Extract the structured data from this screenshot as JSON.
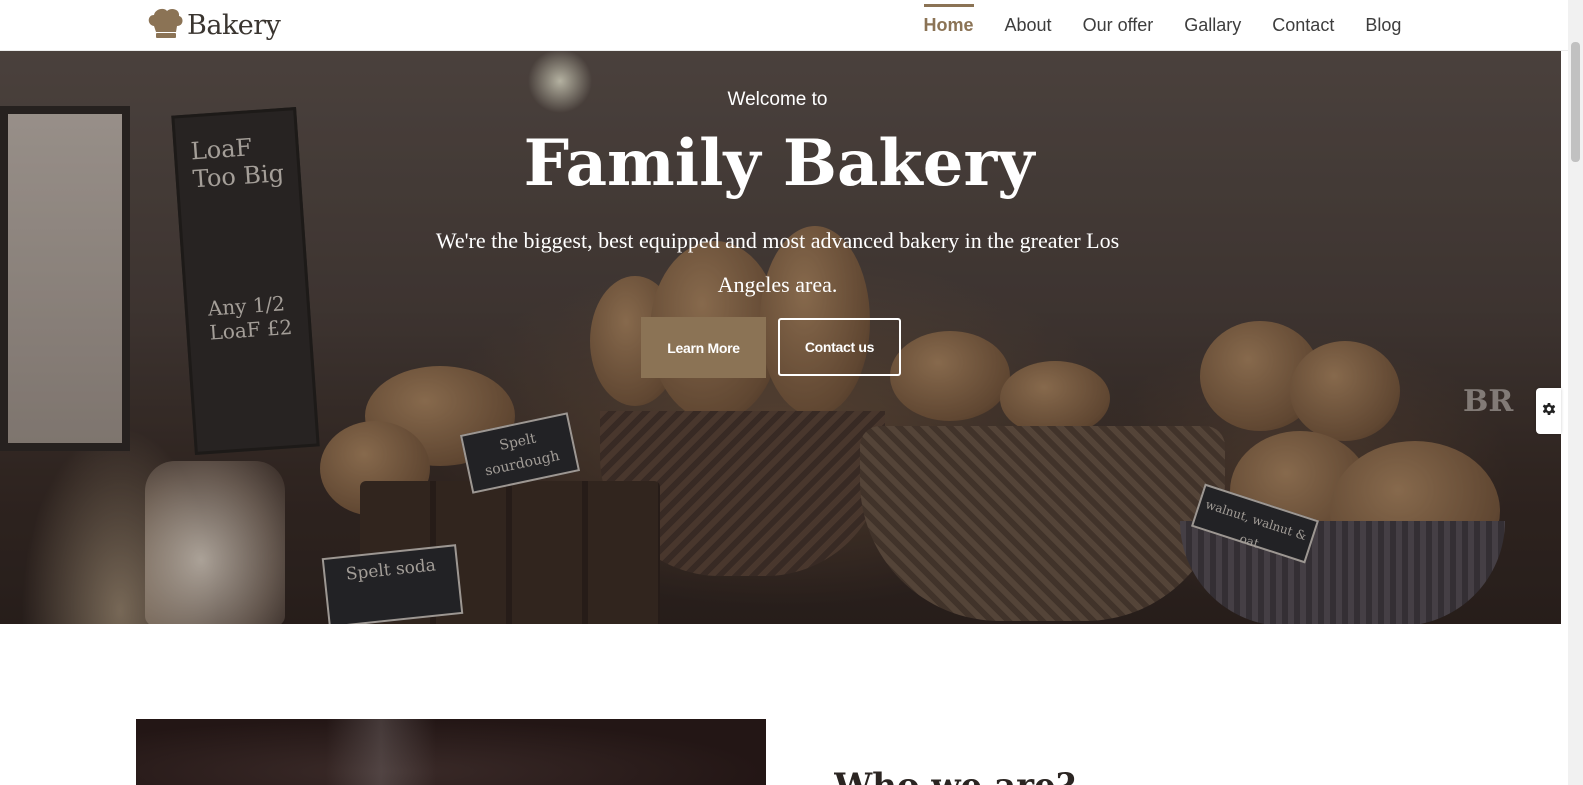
{
  "brand": {
    "name": "Bakery",
    "icon": "chef-hat-icon",
    "color": "#8b7355"
  },
  "nav": {
    "items": [
      {
        "label": "Home",
        "active": true
      },
      {
        "label": "About",
        "active": false
      },
      {
        "label": "Our offer",
        "active": false
      },
      {
        "label": "Gallary",
        "active": false
      },
      {
        "label": "Contact",
        "active": false
      },
      {
        "label": "Blog",
        "active": false
      }
    ]
  },
  "hero": {
    "welcome": "Welcome to",
    "title": "Family Bakery",
    "lead": "We're the biggest, best equipped and most advanced bakery in the greater Los Angeles area.",
    "primary_button": "Learn More",
    "secondary_button": "Contact us",
    "image_signs": [
      "LoaF Too Big",
      "Any 1/2 LoaF £2",
      "Spelt sourdough",
      "Spelt soda",
      "walnut, walnut & oat",
      "BR"
    ]
  },
  "settings": {
    "icon": "gear-icon"
  },
  "about": {
    "heading_partial": "Who we are?"
  }
}
